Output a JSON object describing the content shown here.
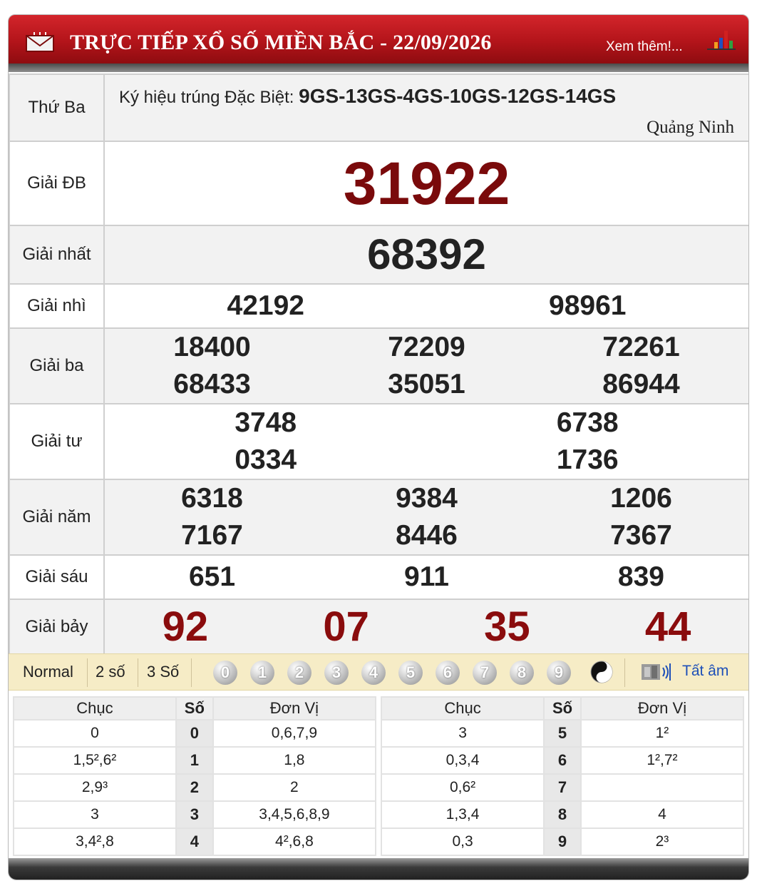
{
  "header": {
    "title": "TRỰC TIẾP XỔ SỐ MIỀN BẮC - 22/09/2026",
    "more_link": "Xem thêm!...",
    "icons": [
      "mail-icon",
      "bar-chart-icon"
    ]
  },
  "info": {
    "day": "Thứ Ba",
    "special_code_label": "Ký hiệu trúng Đặc Biệt:",
    "special_code": "9GS-13GS-4GS-10GS-12GS-14GS",
    "province": "Quảng Ninh"
  },
  "prizes": {
    "db": {
      "label": "Giải ĐB",
      "numbers": [
        "31922"
      ]
    },
    "g1": {
      "label": "Giải nhất",
      "numbers": [
        "68392"
      ]
    },
    "g2": {
      "label": "Giải nhì",
      "numbers": [
        "42192",
        "98961"
      ]
    },
    "g3": {
      "label": "Giải ba",
      "numbers": [
        "18400",
        "72209",
        "72261",
        "68433",
        "35051",
        "86944"
      ]
    },
    "g4": {
      "label": "Giải tư",
      "numbers": [
        "3748",
        "6738",
        "0334",
        "1736"
      ]
    },
    "g5": {
      "label": "Giải năm",
      "numbers": [
        "6318",
        "9384",
        "1206",
        "7167",
        "8446",
        "7367"
      ]
    },
    "g6": {
      "label": "Giải sáu",
      "numbers": [
        "651",
        "911",
        "839"
      ]
    },
    "g7": {
      "label": "Giải bảy",
      "numbers": [
        "92",
        "07",
        "35",
        "44"
      ]
    }
  },
  "toolbar": {
    "modes": [
      "Normal",
      "2 số",
      "3 Số"
    ],
    "digits": [
      "0",
      "1",
      "2",
      "3",
      "4",
      "5",
      "6",
      "7",
      "8",
      "9"
    ],
    "mute_label": "Tất âm"
  },
  "loto": {
    "headers": {
      "chuc": "Chục",
      "so": "Số",
      "don_vi": "Đơn Vị"
    },
    "rows": [
      {
        "chuc": "0",
        "so": "0",
        "don_vi": "0,6,7,9"
      },
      {
        "chuc": "1,5²,6²",
        "so": "1",
        "don_vi": "1,8"
      },
      {
        "chuc": "2,9³",
        "so": "2",
        "don_vi": "2"
      },
      {
        "chuc": "3",
        "so": "3",
        "don_vi": "3,4,5,6,8,9"
      },
      {
        "chuc": "3,4²,8",
        "so": "4",
        "don_vi": "4²,6,8"
      },
      {
        "chuc": "3",
        "so": "5",
        "don_vi": "1²"
      },
      {
        "chuc": "0,3,4",
        "so": "6",
        "don_vi": "1²,7²"
      },
      {
        "chuc": "0,6²",
        "so": "7",
        "don_vi": ""
      },
      {
        "chuc": "1,3,4",
        "so": "8",
        "don_vi": "4"
      },
      {
        "chuc": "0,3",
        "so": "9",
        "don_vi": "2³"
      }
    ]
  },
  "colors": {
    "header_red": "#b3141a",
    "special_prize": "#7a0a0b",
    "link_blue": "#1d4fb8",
    "toolbar_bg": "#f6ecc6"
  }
}
